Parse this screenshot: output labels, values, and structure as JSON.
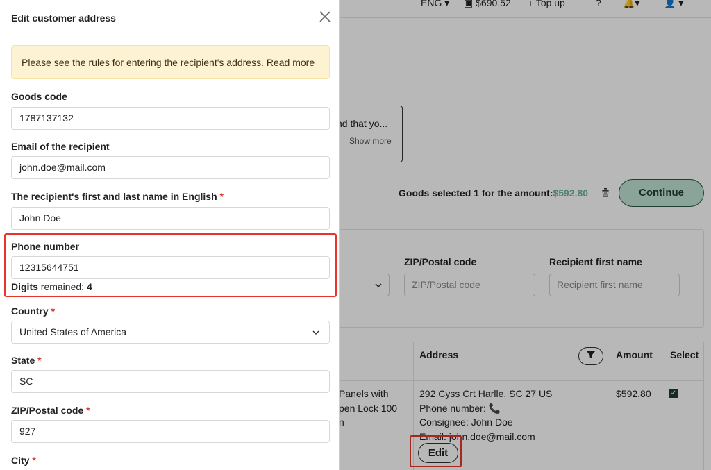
{
  "background": {
    "topbar": {
      "language": "ENG ▾",
      "balance": "$690.52",
      "topup": "+ Top up",
      "help": "?"
    },
    "notice": {
      "text": "nd that yo...",
      "show_more": "Show more"
    },
    "goods_selected_label": "Goods selected 1 for the amount:",
    "goods_selected_amount": "$592.80",
    "continue_label": "Continue",
    "filters": {
      "zip_label": "ZIP/Postal code",
      "zip_placeholder": "ZIP/Postal code",
      "first_name_label": "Recipient first name",
      "first_name_placeholder": "Recipient first name"
    },
    "table": {
      "headers": {
        "address": "Address",
        "amount": "Amount",
        "select": "Select"
      },
      "row": {
        "goods_line1": "Panels with",
        "goods_line2": "pen Lock 100",
        "goods_line3": "n",
        "address_line": "292 Cyss Crt Harlle, SC 27 US",
        "phone_line": "Phone number:",
        "consignee_line": "Consignee: John Doe",
        "email_line": "Email: john.doe@mail.com",
        "amount": "$592.80",
        "edit_label": "Edit"
      }
    }
  },
  "modal": {
    "title": "Edit customer address",
    "alert_text": "Please see the rules for entering the recipient's address.",
    "alert_link": "Read more",
    "fields": {
      "goods_code": {
        "label": "Goods code",
        "value": "1787137132"
      },
      "email": {
        "label": "Email of the recipient",
        "value": "john.doe@mail.com"
      },
      "name": {
        "label": "The recipient's first and last name in English",
        "value": "John Doe"
      },
      "phone": {
        "label": "Phone number",
        "value": "12315644751",
        "digits_label": "Digits",
        "remained_label": "remained:",
        "remained_value": "4"
      },
      "country": {
        "label": "Country",
        "value": "United States of America"
      },
      "state": {
        "label": "State",
        "value": "SC"
      },
      "zip": {
        "label": "ZIP/Postal code",
        "value": "927"
      },
      "city": {
        "label": "City"
      }
    },
    "required_mark": "*"
  },
  "colors": {
    "accent_green": "#6fb59c",
    "highlight_red": "#e8352b",
    "alert_bg": "#fdf3d2"
  }
}
